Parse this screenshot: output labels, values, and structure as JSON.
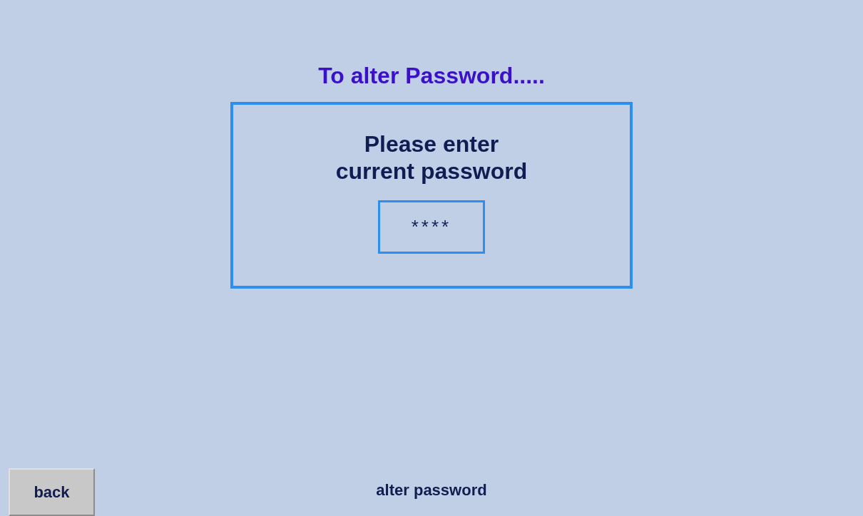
{
  "title": "To alter Password.....",
  "prompt": {
    "lines": [
      "Please enter",
      "current password"
    ],
    "password": {
      "value": "****"
    }
  },
  "footer": {
    "back_button": "back",
    "screen_name": "alter password"
  }
}
